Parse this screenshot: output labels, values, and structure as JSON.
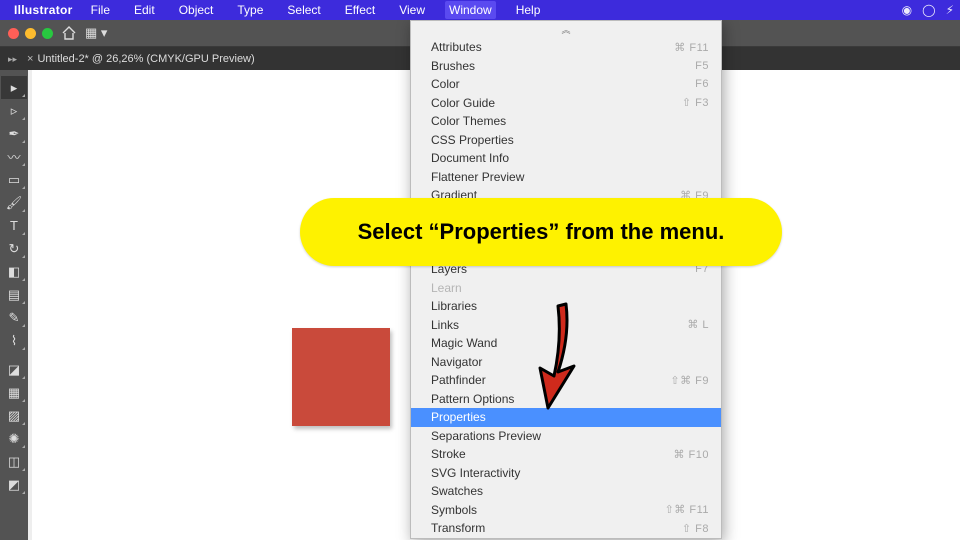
{
  "menubar": {
    "app_name": "Illustrator",
    "items": [
      "File",
      "Edit",
      "Object",
      "Type",
      "Select",
      "Effect",
      "View",
      "Window",
      "Help"
    ],
    "active_index": 7,
    "status_cc": "◉",
    "status_user": "◯",
    "status_batt": "⚡︎"
  },
  "tab": {
    "close": "×",
    "title": "Untitled-2* @ 26,26% (CMYK/GPU Preview)"
  },
  "tools": [
    {
      "name": "selection",
      "g": "▸",
      "sel": true
    },
    {
      "name": "direct-select",
      "g": "▹"
    },
    {
      "name": "pen",
      "g": "✒"
    },
    {
      "name": "curvature",
      "g": "〰"
    },
    {
      "name": "rectangle",
      "g": "▭"
    },
    {
      "name": "paintbrush",
      "g": "🖌"
    },
    {
      "name": "type",
      "g": "T"
    },
    {
      "name": "rotate",
      "g": "↻"
    },
    {
      "name": "eraser",
      "g": "◧"
    },
    {
      "name": "gradient",
      "g": "▤"
    },
    {
      "name": "eyedropper",
      "g": "✎"
    },
    {
      "name": "shaper",
      "g": "⌇"
    },
    {
      "name": "gap",
      "g": ""
    },
    {
      "name": "fill-stroke",
      "g": "◪"
    },
    {
      "name": "artboard",
      "g": "▦"
    },
    {
      "name": "perspective",
      "g": "▨"
    },
    {
      "name": "symbol-sprayer",
      "g": "✺"
    },
    {
      "name": "column-graph",
      "g": "◫"
    },
    {
      "name": "slice",
      "g": "◩"
    }
  ],
  "menu": {
    "scroll_indicator": "︽",
    "items": [
      {
        "label": "Attributes",
        "sc": "⌘ F11"
      },
      {
        "label": "Brushes",
        "sc": "F5"
      },
      {
        "label": "Color",
        "sc": "F6"
      },
      {
        "label": "Color Guide",
        "sc": "⇧ F3"
      },
      {
        "label": "Color Themes",
        "sc": ""
      },
      {
        "label": "CSS Properties",
        "sc": ""
      },
      {
        "label": "Document Info",
        "sc": ""
      },
      {
        "label": "Flattener Preview",
        "sc": ""
      },
      {
        "label": "Gradient",
        "sc": "⌘ F9"
      },
      {
        "label": "",
        "sc": "",
        "hidden": true
      },
      {
        "label": "",
        "sc": "",
        "hidden": true
      },
      {
        "label": "",
        "sc": "",
        "hidden": true
      },
      {
        "label": "Layers",
        "sc": "F7",
        "covered": true
      },
      {
        "label": "Learn",
        "sc": "",
        "disabled": true
      },
      {
        "label": "Libraries",
        "sc": ""
      },
      {
        "label": "Links",
        "sc": "⌘ L"
      },
      {
        "label": "Magic Wand",
        "sc": ""
      },
      {
        "label": "Navigator",
        "sc": ""
      },
      {
        "label": "Pathfinder",
        "sc": "⇧⌘ F9"
      },
      {
        "label": "Pattern Options",
        "sc": ""
      },
      {
        "label": "Properties",
        "sc": "",
        "selected": true
      },
      {
        "label": "Separations Preview",
        "sc": ""
      },
      {
        "label": "Stroke",
        "sc": "⌘ F10"
      },
      {
        "label": "SVG Interactivity",
        "sc": ""
      },
      {
        "label": "Swatches",
        "sc": ""
      },
      {
        "label": "Symbols",
        "sc": "⇧⌘ F11"
      },
      {
        "label": "Transform",
        "sc": "⇧ F8"
      }
    ]
  },
  "callout": {
    "text": "Select “Properties” from the menu."
  },
  "canvas": {
    "shape_color": "#c94a3b"
  }
}
